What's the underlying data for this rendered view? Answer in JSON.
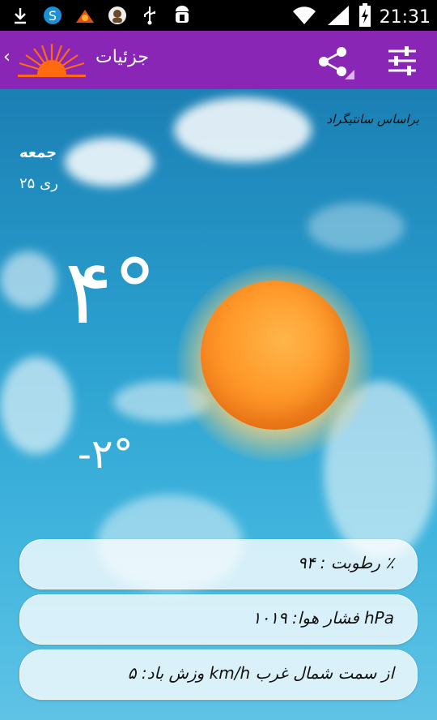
{
  "status_bar": {
    "time": "21:31",
    "icons": [
      "download-icon",
      "skype-icon",
      "app-icon",
      "avatar-icon",
      "usb-icon",
      "android-debug-icon",
      "wifi-icon",
      "signal-icon",
      "battery-charging-icon"
    ]
  },
  "action_bar": {
    "back_glyph": "‹",
    "title": "جزئيات",
    "share_icon": "share-icon",
    "settings_icon": "sliders-icon",
    "accent": "#8a26b5"
  },
  "weather": {
    "source": "براساس سانتیگراد",
    "day": "جمعه",
    "date": "۲۵ ری",
    "temp_high": "۴°",
    "temp_low": "-۲°",
    "humidity": "رطوبت : ۹۴ ٪",
    "pressure": "فشار هوا: ۱۰۱۹ hPa",
    "wind": "وزش باد: ۵ km/h از سمت شمال غرب"
  }
}
